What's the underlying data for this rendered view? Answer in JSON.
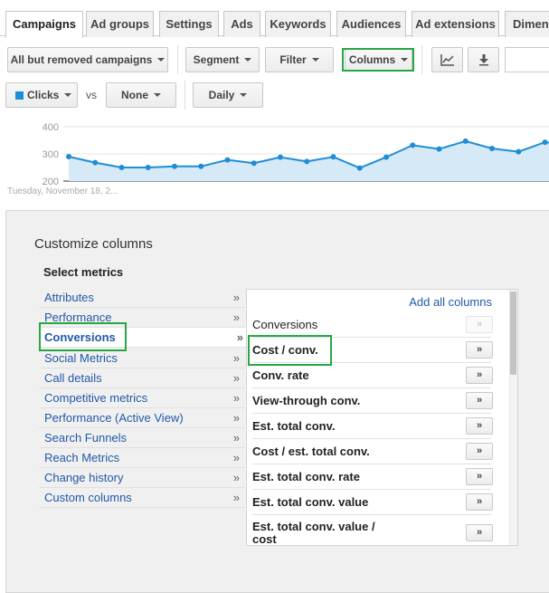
{
  "tabs": [
    "Campaigns",
    "Ad groups",
    "Settings",
    "Ads",
    "Keywords",
    "Audiences",
    "Ad extensions",
    "Dimens"
  ],
  "toolbar": {
    "filter_campaigns": "All but removed campaigns",
    "segment": "Segment",
    "filter": "Filter",
    "columns": "Columns",
    "metric1": "Clicks",
    "vs": "vs",
    "metric2": "None",
    "period": "Daily"
  },
  "chart_data": {
    "type": "line",
    "y_ticks": [
      "400",
      "300",
      "200"
    ],
    "ylim": [
      200,
      400
    ],
    "values": [
      290,
      268,
      250,
      250,
      254,
      254,
      278,
      266,
      288,
      272,
      289,
      248,
      288,
      332,
      318,
      347,
      320,
      308,
      343,
      335
    ],
    "x_label": "Tuesday, November 18, 2...",
    "color": "#1f8dd6",
    "fill": "#d6e9f6"
  },
  "panel": {
    "title": "Customize columns",
    "select_metrics": "Select metrics",
    "categories": [
      "Attributes",
      "Performance",
      "Conversions",
      "Social Metrics",
      "Call details",
      "Competitive metrics",
      "Performance (Active View)",
      "Search Funnels",
      "Reach Metrics",
      "Change history",
      "Custom columns"
    ],
    "chevron": "»",
    "add_all": "Add all columns",
    "metrics": [
      "Conversions",
      "Cost / conv.",
      "Conv. rate",
      "View-through conv.",
      "Est. total conv.",
      "Cost / est. total conv.",
      "Est. total conv. rate",
      "Est. total conv. value",
      "Est. total conv. value / cost"
    ],
    "add_label": "»"
  }
}
